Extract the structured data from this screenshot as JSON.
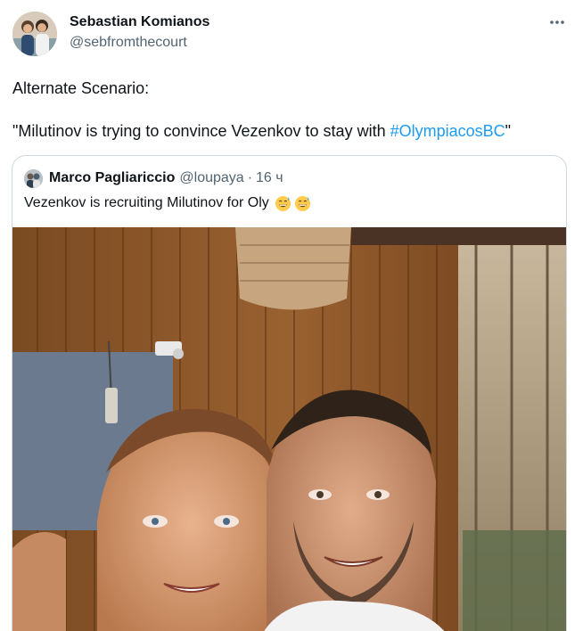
{
  "author": {
    "name": "Sebastian Komianos",
    "handle": "@sebfromthecourt"
  },
  "tweet": {
    "line1": "Alternate Scenario:",
    "line2_prefix": "\"Milutinov is trying to convince Vezenkov to stay with ",
    "hashtag": "#OlympiacosBC",
    "line2_suffix": "\""
  },
  "quoted": {
    "name": "Marco Pagliariccio",
    "handle": "@loupaya",
    "separator": "·",
    "time": "16 ч",
    "text": "Vezenkov is recruiting Milutinov for Oly",
    "emojis": [
      "grinning-sweat-emoji",
      "grinning-sweat-emoji"
    ]
  },
  "icons": {
    "more": "more-horizontal-icon"
  },
  "colors": {
    "link": "#1d9bf0",
    "secondary_text": "#536471",
    "border": "#cfd9de"
  }
}
